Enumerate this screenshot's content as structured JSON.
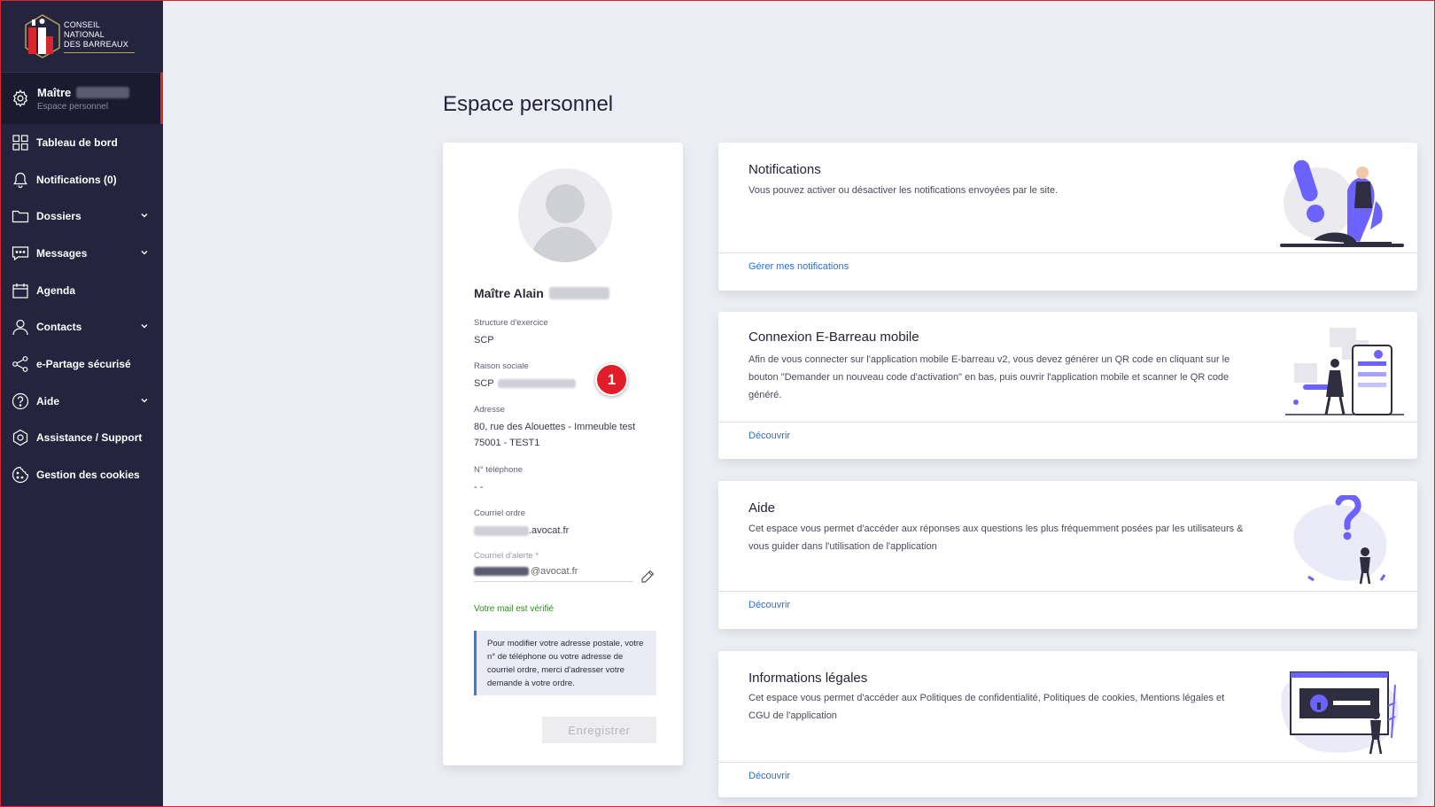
{
  "brand": {
    "line1": "CONSEIL NATIONAL",
    "line2": "DES BARREAUX"
  },
  "sidebar": {
    "user": {
      "name": "Maître",
      "subtitle": "Espace personnel"
    },
    "items": [
      {
        "label": "Tableau de bord",
        "icon": "grid-icon",
        "expandable": false
      },
      {
        "label": "Notifications (0)",
        "icon": "bell-icon",
        "expandable": false
      },
      {
        "label": "Dossiers",
        "icon": "folder-icon",
        "expandable": true
      },
      {
        "label": "Messages",
        "icon": "chat-icon",
        "expandable": true
      },
      {
        "label": "Agenda",
        "icon": "calendar-icon",
        "expandable": false
      },
      {
        "label": "Contacts",
        "icon": "person-icon",
        "expandable": true
      },
      {
        "label": "e-Partage sécurisé",
        "icon": "share-icon",
        "expandable": false
      },
      {
        "label": "Aide",
        "icon": "help-icon",
        "expandable": true
      },
      {
        "label": "Assistance / Support",
        "icon": "support-icon",
        "expandable": false
      },
      {
        "label": "Gestion des cookies",
        "icon": "cookie-icon",
        "expandable": false
      }
    ]
  },
  "page": {
    "title": "Espace personnel"
  },
  "profile": {
    "name": "Maître Alain",
    "structure_label": "Structure d'exercice",
    "structure_value": "SCP",
    "raison_label": "Raison sociale",
    "raison_value": "SCP",
    "address_label": "Adresse",
    "address_line1": "80, rue des Alouettes - Immeuble test",
    "address_line2": "75001 - TEST1",
    "phone_label": "N° téléphone",
    "phone_value": "- -",
    "courriel_label": "Courriel ordre",
    "courriel_suffix": ".avocat.fr",
    "alert_label": "Courriel d'alerte *",
    "alert_suffix": "@avocat.fr",
    "verified": "Votre mail est vérifié",
    "info": "Pour modifier votre adresse postale, votre n° de téléphone ou votre adresse de courriel ordre, merci d'adresser votre demande à votre ordre.",
    "save_label": "Enregistrer",
    "badge": "1"
  },
  "cards": [
    {
      "title": "Notifications",
      "desc": "Vous pouvez activer ou désactiver les notifications envoyées par le site.",
      "link": "Gérer mes notifications"
    },
    {
      "title": "Connexion E-Barreau mobile",
      "desc": "Afin de vous connecter sur l'application mobile E-barreau v2, vous devez générer un QR code en cliquant sur le bouton \"Demander un nouveau code d'activation\" en bas, puis ouvrir l'application mobile et scanner le QR code généré.",
      "link": "Découvrir"
    },
    {
      "title": "Aide",
      "desc": "Cet espace vous permet d'accéder aux réponses aux questions les plus fréquemment posées par les utilisateurs & vous guider dans l'utilisation de l'application",
      "link": "Découvrir"
    },
    {
      "title": "Informations légales",
      "desc": "Cet espace vous permet d'accéder aux Politiques de confidentialité, Politiques de cookies, Mentions légales et CGU de l'application",
      "link": "Découvrir"
    }
  ],
  "colors": {
    "sidebar": "#24243e",
    "accent_red": "#d9262c",
    "link_blue": "#2b6fd6",
    "illustration_purple": "#6c63ff",
    "verified_green": "#2c8a1c"
  }
}
